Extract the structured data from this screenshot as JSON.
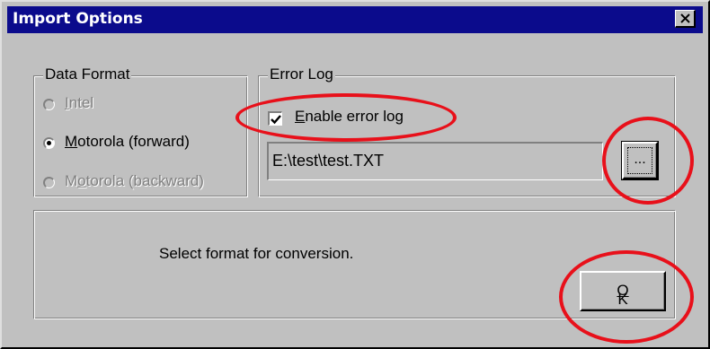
{
  "window": {
    "title": "Import Options",
    "close_symbol": "✕"
  },
  "data_format": {
    "legend": "Data Format",
    "options": [
      {
        "label_pre": "",
        "label_key": "I",
        "label_post": "ntel",
        "selected": false,
        "enabled": false
      },
      {
        "label_pre": "",
        "label_key": "M",
        "label_post": "otorola (forward)",
        "selected": true,
        "enabled": true
      },
      {
        "label_pre": "M",
        "label_key": "o",
        "label_post": "torola (backward)",
        "selected": false,
        "enabled": false
      }
    ]
  },
  "error_log": {
    "legend": "Error Log",
    "checkbox": {
      "label_key": "E",
      "label_post": "nable error log",
      "checked": true
    },
    "path_value": "E:\\test\\test.TXT",
    "browse_label": "..."
  },
  "status": {
    "message": "Select format for conversion."
  },
  "ok_button": {
    "label_key": "O",
    "label_post": "K"
  },
  "colors": {
    "face": "#c0c0c0",
    "titlebar": "#0b0b8c",
    "annotation": "#e8101a"
  },
  "icons": {
    "close": "close-icon",
    "check": "check-icon"
  }
}
